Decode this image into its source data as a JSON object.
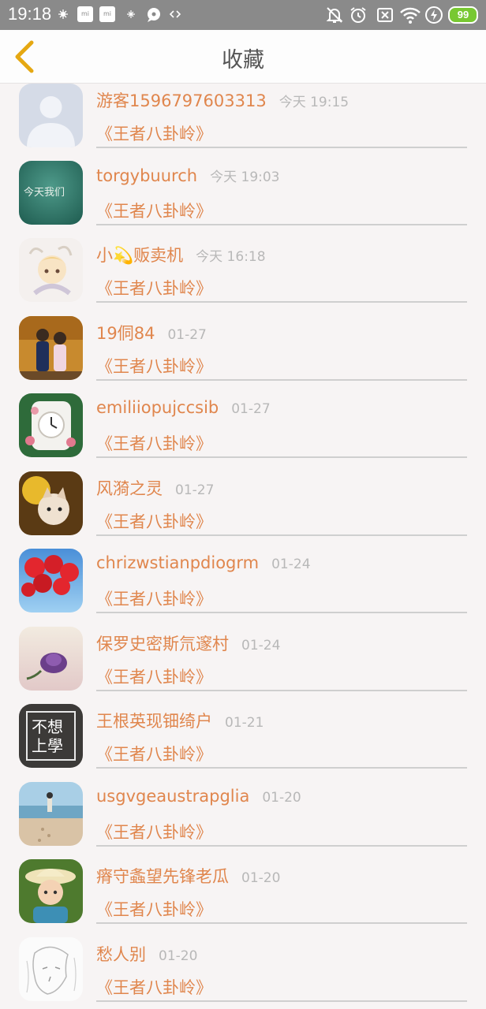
{
  "status_bar": {
    "time": "19:18",
    "notification_icons": [
      "mi-icon",
      "mi-icon",
      "sparkle-icon",
      "chat-bubble-icon",
      "code-icon"
    ],
    "right_icons": [
      "mute-icon",
      "alarm-icon",
      "no-sim-icon",
      "wifi-icon",
      "flash-icon"
    ],
    "battery": "99"
  },
  "header": {
    "title": "收藏",
    "back_icon": "chevron-left-icon",
    "accent_color": "#e5a812"
  },
  "items": [
    {
      "name": "游客1596797603313",
      "time": "今天 19:15",
      "subject": "《王者八卦岭》"
    },
    {
      "name": "torgybuurch",
      "time": "今天 19:03",
      "subject": "《王者八卦岭》"
    },
    {
      "name": "小💫贩卖机",
      "time": "今天 16:18",
      "subject": "《王者八卦岭》"
    },
    {
      "name": "19侗84",
      "time": "01-27",
      "subject": "《王者八卦岭》"
    },
    {
      "name": "emiliiopujccsib",
      "time": "01-27",
      "subject": "《王者八卦岭》"
    },
    {
      "name": "风漪之灵",
      "time": "01-27",
      "subject": "《王者八卦岭》"
    },
    {
      "name": "chrizwstianpdiogrm",
      "time": "01-24",
      "subject": "《王者八卦岭》"
    },
    {
      "name": "保罗史密斯氘邃村",
      "time": "01-24",
      "subject": "《王者八卦岭》"
    },
    {
      "name": "王根英现钿绮户",
      "time": "01-21",
      "subject": "《王者八卦岭》"
    },
    {
      "name": "usgvgeaustrapglia",
      "time": "01-20",
      "subject": "《王者八卦岭》"
    },
    {
      "name": "瘠守螽望先锋老瓜",
      "time": "01-20",
      "subject": "《王者八卦岭》"
    },
    {
      "name": "愁人别",
      "time": "01-20",
      "subject": "《王者八卦岭》"
    }
  ],
  "avatar_texts": {
    "chalkboard": "今天我们",
    "poster_line1": "不想",
    "poster_line2": "上學"
  },
  "colors": {
    "name_text": "#e0864d",
    "time_text": "#b8b8b8",
    "status_bar": "#8a8a8a",
    "battery": "#78c832"
  }
}
